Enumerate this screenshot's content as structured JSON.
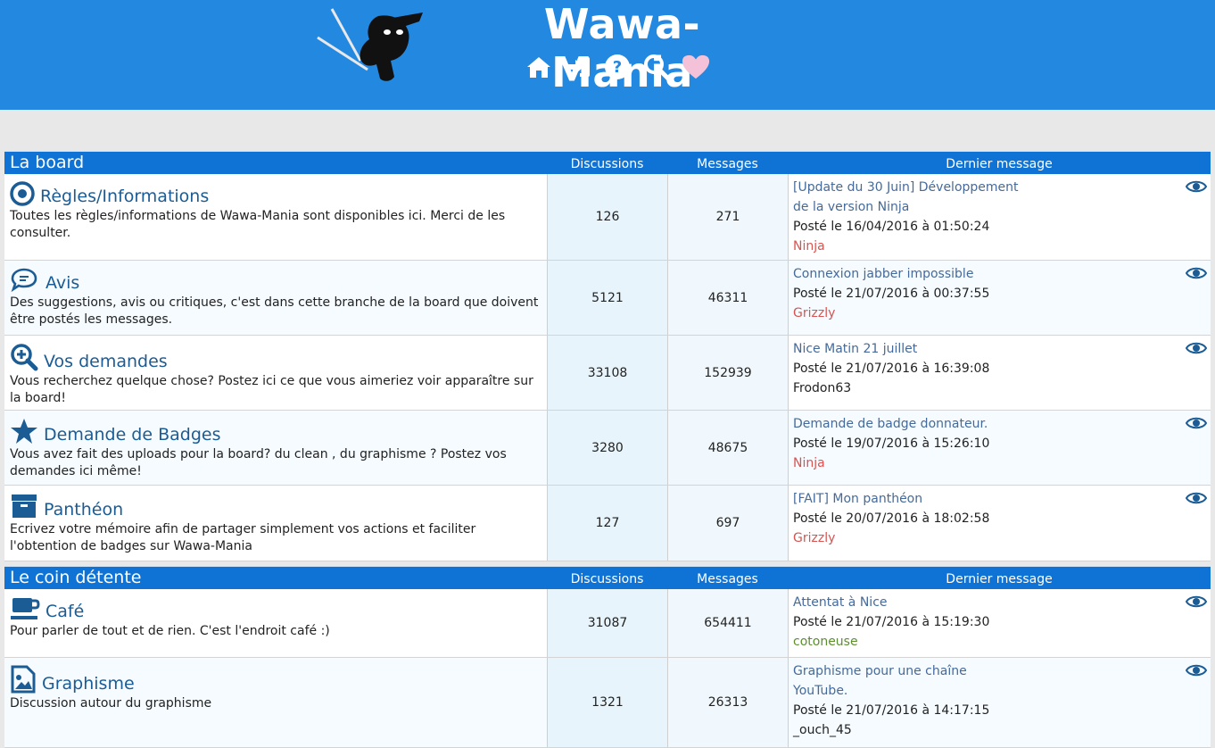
{
  "site": {
    "title": "Wawa-Mania"
  },
  "nav": {
    "icons": [
      "home-icon",
      "sign-in-icon",
      "help-icon",
      "search-icon",
      "heart-icon"
    ],
    "colors": {
      "icon": "#ffffff",
      "heart": "#f4c2d8"
    }
  },
  "colors": {
    "header": "#2388e0",
    "section_bar": "#0f73d6",
    "link": "#1b5c95",
    "user_red": "#d9534f",
    "user_green": "#5b8f2e"
  },
  "sections": [
    {
      "title": "La board",
      "col_discussions": "Discussions",
      "col_messages": "Messages",
      "col_last": "Dernier message",
      "forums": [
        {
          "icon": "dot-circle-icon",
          "name": "Règles/Informations",
          "desc": "Toutes les règles/informations de Wawa-Mania sont disponibles ici. Merci de les consulter.",
          "discussions": "126",
          "messages": "271",
          "last_title": "[Update du 30 Juin] Développement de la version Ninja",
          "last_date": "Posté le 16/04/2016 à 01:50:24",
          "last_user": "Ninja",
          "user_color": "#d9534f"
        },
        {
          "icon": "comments-icon",
          "name": "Avis",
          "desc": "Des suggestions, avis ou critiques, c'est dans cette branche de la board que doivent être postés les messages.",
          "discussions": "5121",
          "messages": "46311",
          "last_title": "Connexion jabber impossible",
          "last_date": "Posté le 21/07/2016 à 00:37:55",
          "last_user": "Grizzly",
          "user_color": "#d9534f"
        },
        {
          "icon": "search-plus-icon",
          "name": "Vos demandes",
          "desc": "Vous recherchez quelque chose? Postez ici ce que vous aimeriez voir apparaître sur la board!",
          "discussions": "33108",
          "messages": "152939",
          "last_title": "Nice Matin 21 juillet",
          "last_date": "Posté le 21/07/2016 à 16:39:08",
          "last_user": "Frodon63",
          "user_color": "#222222"
        },
        {
          "icon": "star-icon",
          "name": "Demande de Badges",
          "desc": "Vous avez fait des uploads pour la board? du clean , du graphisme ? Postez vos demandes ici même!",
          "discussions": "3280",
          "messages": "48675",
          "last_title": "Demande de badge donnateur.",
          "last_date": "Posté le 19/07/2016 à 15:26:10",
          "last_user": "Ninja",
          "user_color": "#d9534f"
        },
        {
          "icon": "archive-icon",
          "name": "Panthéon",
          "desc": "Ecrivez votre mémoire afin de partager simplement vos actions et faciliter l'obtention de badges sur Wawa-Mania",
          "discussions": "127",
          "messages": "697",
          "last_title": "[FAIT] Mon panthéon",
          "last_date": "Posté le 20/07/2016 à 18:02:58",
          "last_user": "Grizzly",
          "user_color": "#d9534f"
        }
      ]
    },
    {
      "title": "Le coin détente",
      "col_discussions": "Discussions",
      "col_messages": "Messages",
      "col_last": "Dernier message",
      "forums": [
        {
          "icon": "coffee-icon",
          "name": "Café",
          "desc": "Pour parler de tout et de rien. C'est l'endroit café :)",
          "discussions": "31087",
          "messages": "654411",
          "last_title": "Attentat à Nice",
          "last_date": "Posté le 21/07/2016 à 15:19:30",
          "last_user": "cotoneuse",
          "user_color": "#5b8f2e"
        },
        {
          "icon": "image-file-icon",
          "name": "Graphisme",
          "desc": "Discussion autour du graphisme",
          "discussions": "1321",
          "messages": "26313",
          "last_title": "Graphisme pour une chaîne YouTube.",
          "last_date": "Posté le 21/07/2016 à 14:17:15",
          "last_user": "_ouch_45",
          "user_color": "#222222"
        }
      ]
    }
  ]
}
